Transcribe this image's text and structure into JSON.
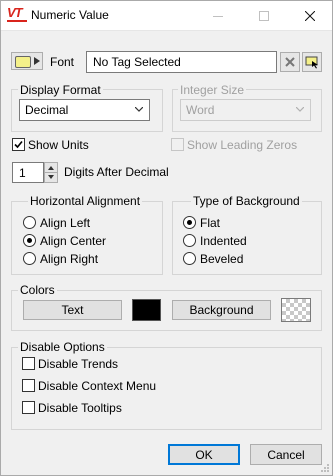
{
  "window": {
    "title": "Numeric Value",
    "logo_text": "VT",
    "accent_color": "#d9241c"
  },
  "font": {
    "label": "Font",
    "tag_value": "No Tag Selected"
  },
  "display_format": {
    "label": "Display Format",
    "selected": "Decimal"
  },
  "integer_size": {
    "label": "Integer Size",
    "selected": "Word"
  },
  "show_units": {
    "label": "Show Units",
    "checked": true
  },
  "show_leading_zeros": {
    "label": "Show Leading Zeros",
    "checked": false,
    "enabled": false
  },
  "digits": {
    "value": "1",
    "label": "Digits After Decimal"
  },
  "horizontal_alignment": {
    "label": "Horizontal Alignment",
    "options": [
      "Align Left",
      "Align Center",
      "Align Right"
    ],
    "selected": "Align Center"
  },
  "background_type": {
    "label": "Type of Background",
    "options": [
      "Flat",
      "Indented",
      "Beveled"
    ],
    "selected": "Flat"
  },
  "colors": {
    "label": "Colors",
    "text_button": "Text",
    "text_color": "#000000",
    "background_button": "Background"
  },
  "disable_options": {
    "label": "Disable Options",
    "items": [
      {
        "label": "Disable Trends",
        "checked": false
      },
      {
        "label": "Disable Context Menu",
        "checked": false
      },
      {
        "label": "Disable Tooltips",
        "checked": false
      }
    ]
  },
  "buttons": {
    "ok": "OK",
    "cancel": "Cancel"
  }
}
